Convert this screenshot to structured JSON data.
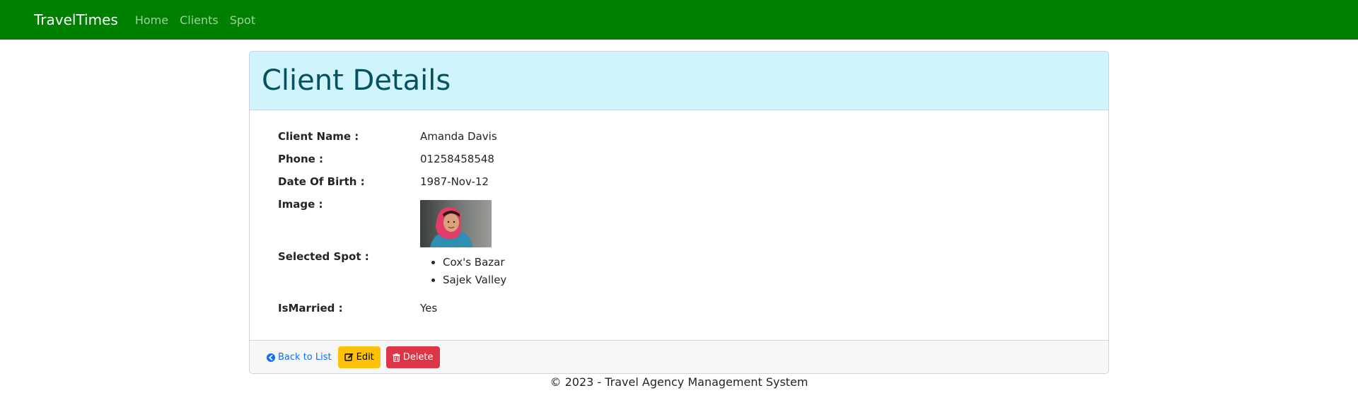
{
  "navbar": {
    "brand": "TravelTimes",
    "links": [
      "Home",
      "Clients",
      "Spot"
    ],
    "background_color": "#008000"
  },
  "card": {
    "title": "Client Details",
    "header_color": "#cff4fc",
    "fields": {
      "client_name_label": "Client Name :",
      "client_name_value": "Amanda Davis",
      "phone_label": "Phone :",
      "phone_value": "01258458548",
      "dob_label": "Date Of Birth :",
      "dob_value": "1987-Nov-12",
      "image_label": "Image :",
      "selected_spot_label": "Selected Spot :",
      "selected_spots": [
        "Cox's Bazar",
        "Sajek Valley"
      ],
      "is_married_label": "IsMarried :",
      "is_married_value": "Yes"
    },
    "actions": {
      "back_label": "Back to List",
      "back_icon": "arrow-circle-left-icon",
      "edit_label": "Edit",
      "edit_icon": "edit-icon",
      "delete_label": "Delete",
      "delete_icon": "trash-icon"
    }
  },
  "footer": {
    "text": "© 2023 - Travel Agency Management System"
  },
  "colors": {
    "edit_button": "#ffc107",
    "delete_button": "#dc3545",
    "link": "#0d6efd",
    "title_text": "#055160"
  }
}
